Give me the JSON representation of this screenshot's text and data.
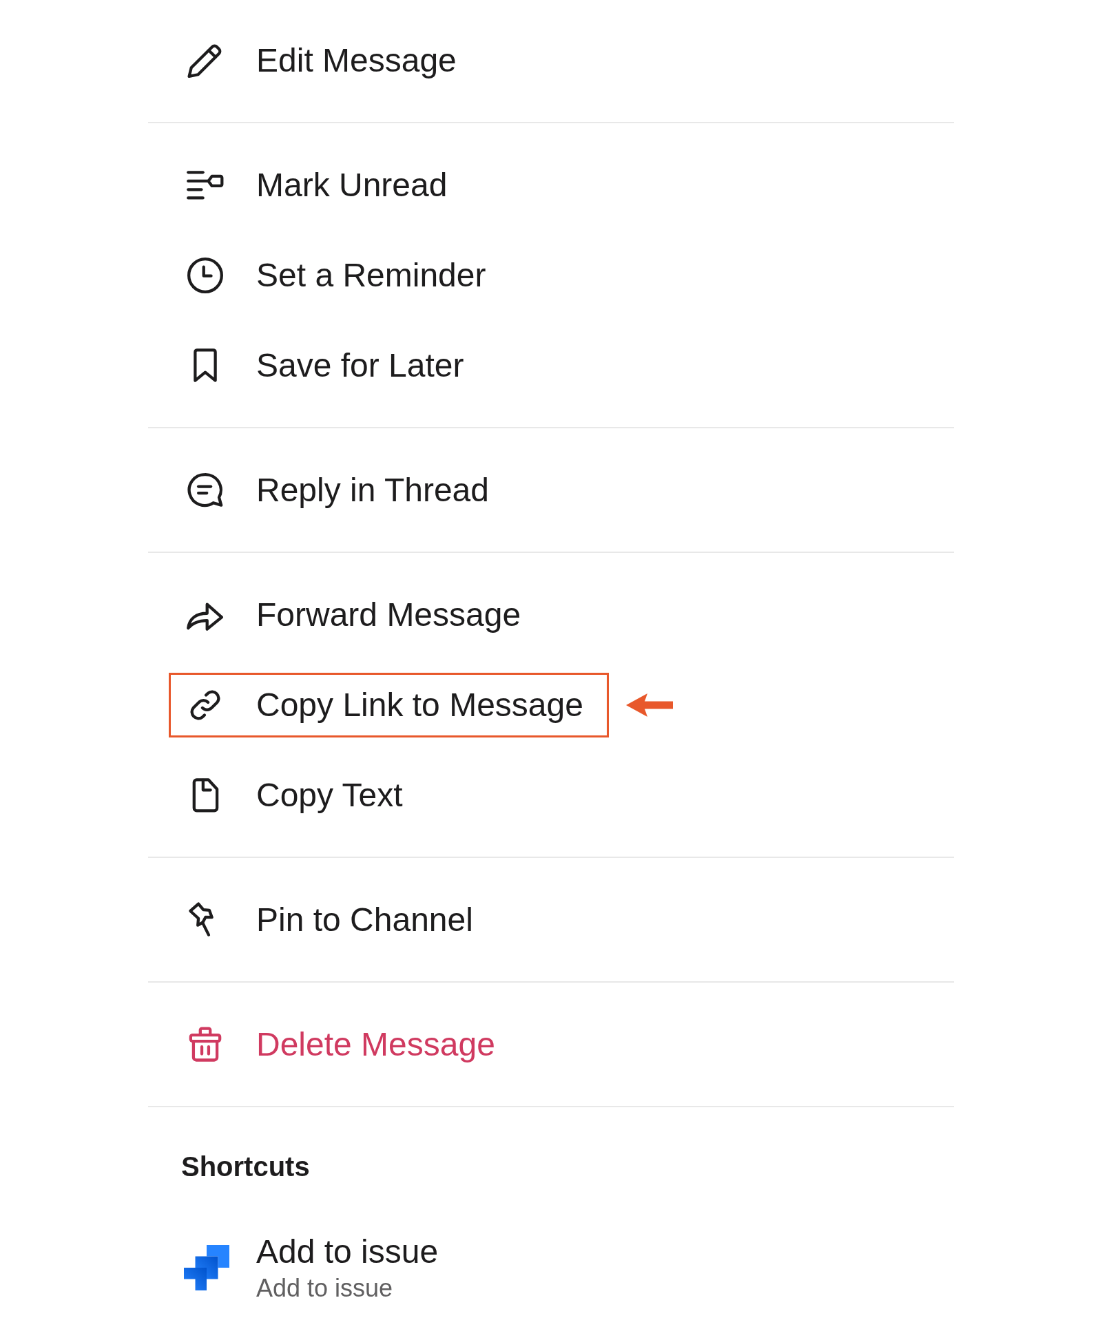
{
  "menu": {
    "groups": [
      {
        "items": [
          {
            "label": "Edit Message",
            "kind": "normal",
            "highlighted": false
          }
        ]
      },
      {
        "items": [
          {
            "label": "Mark Unread",
            "kind": "normal",
            "highlighted": false
          },
          {
            "label": "Set a Reminder",
            "kind": "normal",
            "highlighted": false
          },
          {
            "label": "Save for Later",
            "kind": "normal",
            "highlighted": false
          }
        ]
      },
      {
        "items": [
          {
            "label": "Reply in Thread",
            "kind": "normal",
            "highlighted": false
          }
        ]
      },
      {
        "items": [
          {
            "label": "Forward Message",
            "kind": "normal",
            "highlighted": false
          },
          {
            "label": "Copy Link to Message",
            "kind": "normal",
            "highlighted": true
          },
          {
            "label": "Copy Text",
            "kind": "normal",
            "highlighted": false
          }
        ]
      },
      {
        "items": [
          {
            "label": "Pin to Channel",
            "kind": "normal",
            "highlighted": false
          }
        ]
      },
      {
        "items": [
          {
            "label": "Delete Message",
            "kind": "danger",
            "highlighted": false
          }
        ]
      }
    ]
  },
  "shortcuts": {
    "title": "Shortcuts",
    "items": [
      {
        "title": "Add to issue",
        "subtitle": "Add to issue"
      }
    ]
  }
}
